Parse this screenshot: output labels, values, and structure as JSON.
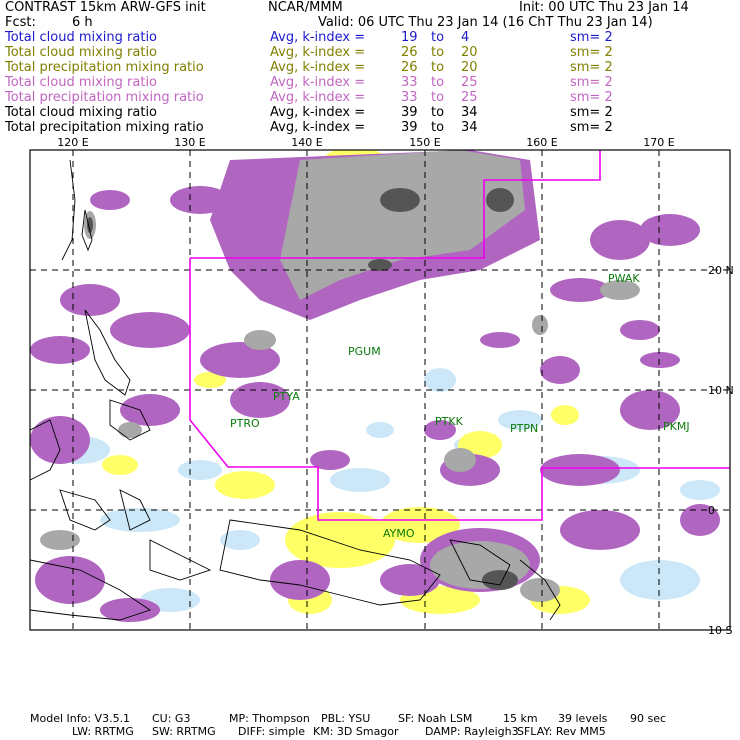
{
  "header": {
    "title": "CONTRAST 15km ARW-GFS init",
    "org": "NCAR/MMM",
    "init": "Init: 00 UTC Thu 23 Jan 14",
    "fcst_label": "Fcst:",
    "fcst_value": "6 h",
    "valid": "Valid: 06 UTC Thu 23 Jan 14 (16 ChT Thu 23 Jan 14)"
  },
  "fields": [
    {
      "name": "Total cloud mixing ratio",
      "avg": "Avg, k-index =",
      "k": "19",
      "to": "to",
      "k2": "4",
      "sm": "sm= 2",
      "color": "#1a1acc"
    },
    {
      "name": "Total cloud mixing ratio",
      "avg": "Avg, k-index =",
      "k": "26",
      "to": "to",
      "k2": "20",
      "sm": "sm= 2",
      "color": "#808000"
    },
    {
      "name": "Total precipitation mixing ratio",
      "avg": "Avg, k-index =",
      "k": "26",
      "to": "to",
      "k2": "20",
      "sm": "sm= 2",
      "color": "#808000"
    },
    {
      "name": "Total cloud mixing ratio",
      "avg": "Avg, k-index =",
      "k": "33",
      "to": "to",
      "k2": "25",
      "sm": "sm= 2",
      "color": "#c266c2"
    },
    {
      "name": "Total precipitation mixing ratio",
      "avg": "Avg, k-index =",
      "k": "33",
      "to": "to",
      "k2": "25",
      "sm": "sm= 2",
      "color": "#c266c2"
    },
    {
      "name": "Total cloud mixing ratio",
      "avg": "Avg, k-index =",
      "k": "39",
      "to": "to",
      "k2": "34",
      "sm": "sm= 2",
      "color": "#000000"
    },
    {
      "name": "Total precipitation mixing ratio",
      "avg": "Avg, k-index =",
      "k": "39",
      "to": "to",
      "k2": "34",
      "sm": "sm= 2",
      "color": "#000000"
    }
  ],
  "map": {
    "lon_labels": [
      "120 E",
      "130 E",
      "140 E",
      "150 E",
      "160 E",
      "170 E"
    ],
    "lat_labels": [
      "20 N",
      "10 N",
      "0",
      "10 S"
    ],
    "stations": [
      "PGUM",
      "PWAK",
      "PTYA",
      "PTRO",
      "PTKK",
      "PTPN",
      "PKMJ",
      "AYMO"
    ],
    "colors": {
      "purple": "#b066c0",
      "yellow": "#ffff66",
      "lightblue": "#cce8f8",
      "gray": "#a8a8a8",
      "darkgray": "#555555",
      "boundary": "#ee00ee",
      "station": "#0a7a0a"
    }
  },
  "footer": {
    "line1": [
      {
        "text": "Model Info: V3.5.1"
      },
      {
        "text": "CU: G3"
      },
      {
        "text": "MP: Thompson"
      },
      {
        "text": "PBL: YSU"
      },
      {
        "text": "SF: Noah LSM"
      },
      {
        "text": "15 km"
      },
      {
        "text": "39 levels"
      },
      {
        "text": "90 sec"
      }
    ],
    "line2": [
      {
        "text": "LW: RRTMG"
      },
      {
        "text": "SW: RRTMG"
      },
      {
        "text": "DIFF: simple"
      },
      {
        "text": "KM: 3D Smagor"
      },
      {
        "text": "DAMP: Rayleigh3"
      },
      {
        "text": "SFLAY: Rev MM5"
      }
    ]
  }
}
